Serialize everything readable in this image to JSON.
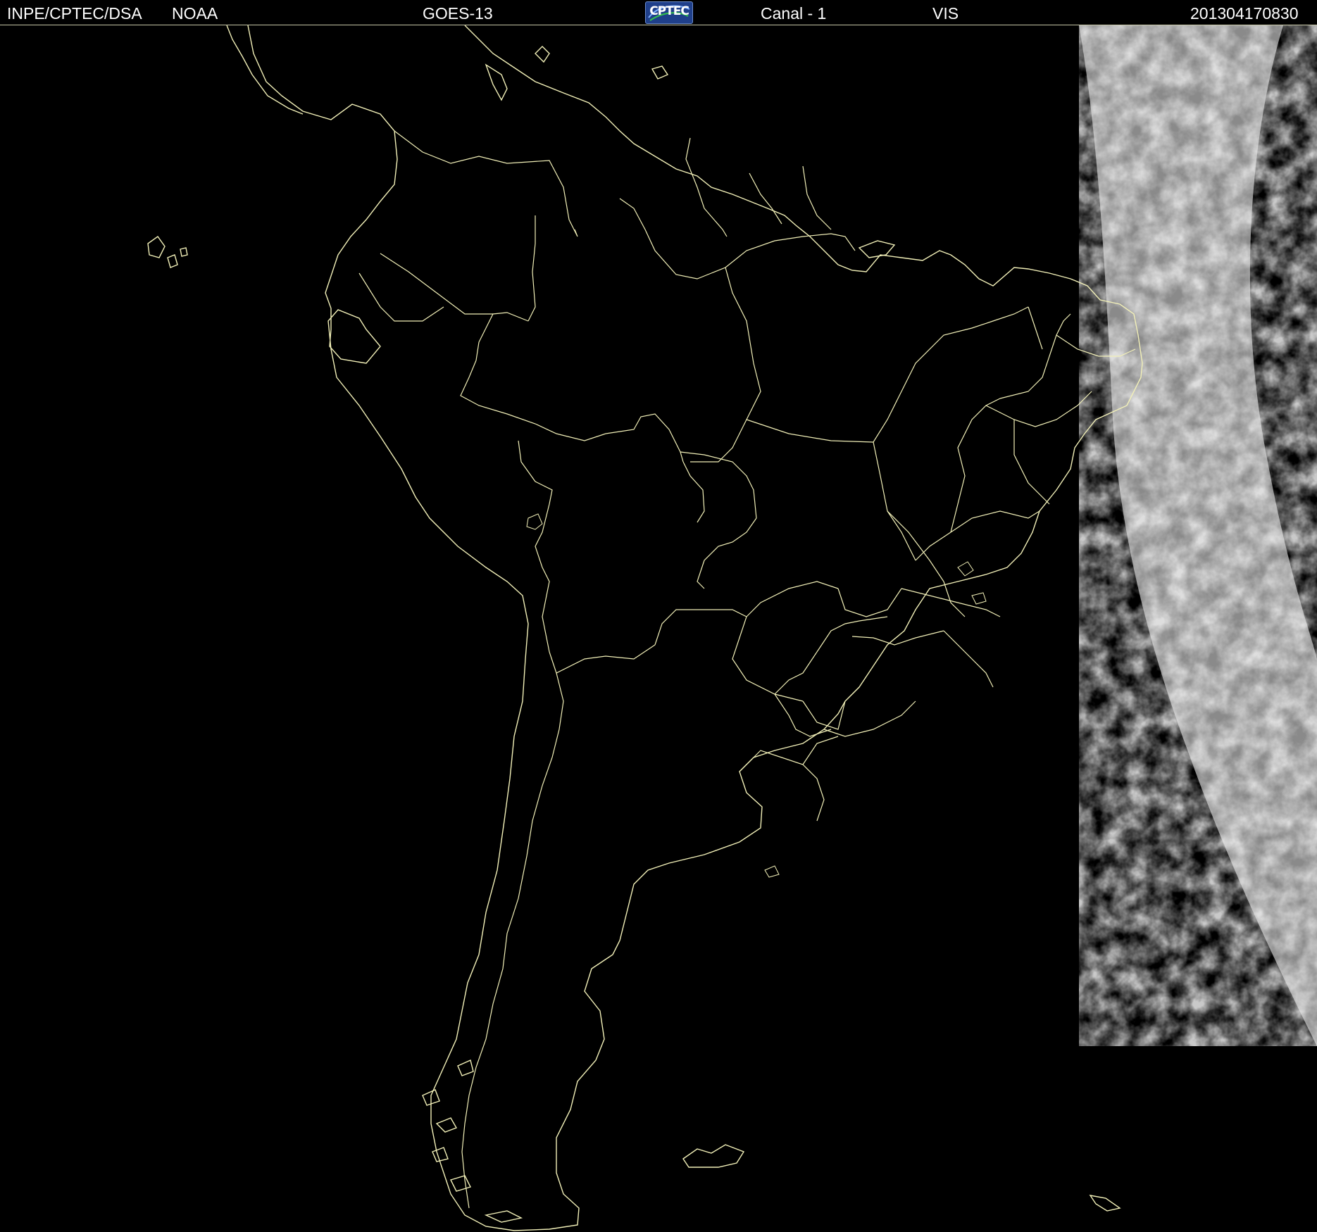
{
  "header": {
    "source": "INPE/CPTEC/DSA",
    "agency": "NOAA",
    "satellite": "GOES-13",
    "logo_text": "CPTEC",
    "channel": "Canal - 1",
    "band": "VIS",
    "timestamp": "201304170830"
  },
  "map": {
    "region": "South America",
    "background_color": "#000000",
    "border_color": "#f2f0b8",
    "cloud_color": "#d8d8d8",
    "logo_color": "#1f3f8a"
  }
}
